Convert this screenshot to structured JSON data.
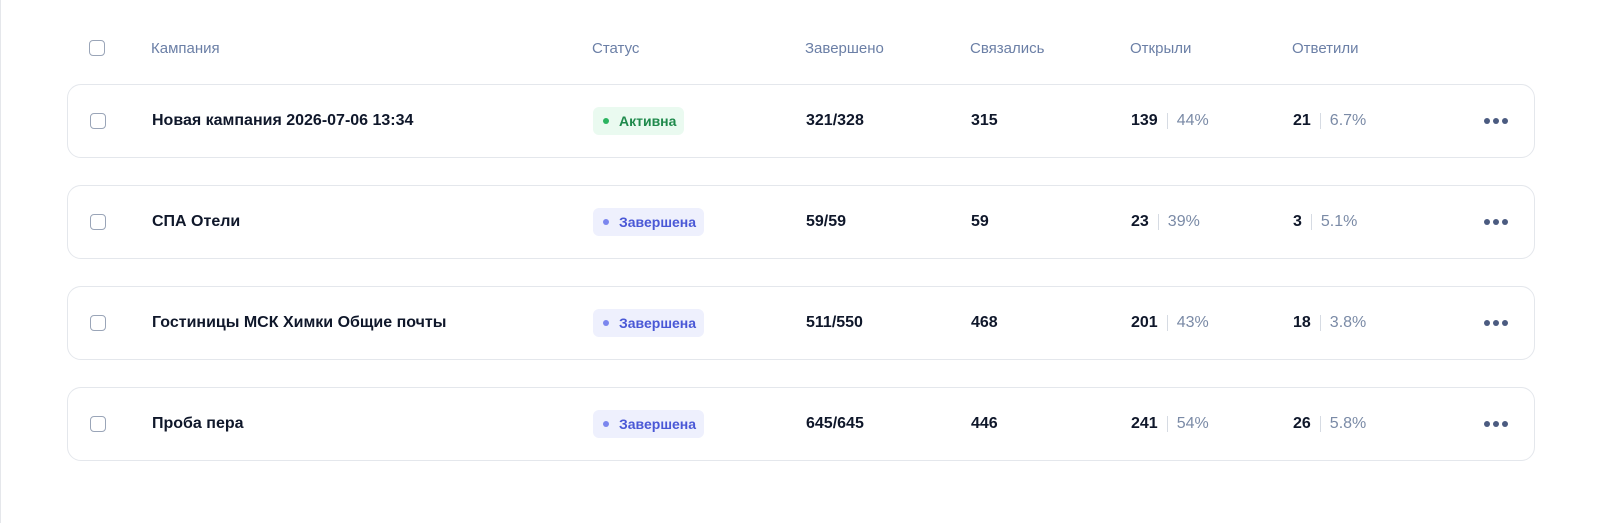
{
  "columns": {
    "campaign": "Кампания",
    "status": "Статус",
    "completed": "Завершено",
    "contacted": "Связались",
    "opened": "Открыли",
    "replied": "Ответили"
  },
  "colors": {
    "active_status": "#1f8a4c",
    "completed_status": "#4a58d6",
    "header_text": "#6b7fa6"
  },
  "rows": [
    {
      "name": "Новая кампания 2026-07-06 13:34",
      "status": "Активна",
      "status_type": "active",
      "completed": "321/328",
      "contacted": "315",
      "opened": "139",
      "opened_pct": "44%",
      "replied": "21",
      "replied_pct": "6.7%"
    },
    {
      "name": "СПА Отели",
      "status": "Завершена",
      "status_type": "done",
      "completed": "59/59",
      "contacted": "59",
      "opened": "23",
      "opened_pct": "39%",
      "replied": "3",
      "replied_pct": "5.1%"
    },
    {
      "name": "Гостиницы МСК Химки Общие почты",
      "status": "Завершена",
      "status_type": "done",
      "completed": "511/550",
      "contacted": "468",
      "opened": "201",
      "opened_pct": "43%",
      "replied": "18",
      "replied_pct": "3.8%"
    },
    {
      "name": "Проба пера",
      "status": "Завершена",
      "status_type": "done",
      "completed": "645/645",
      "contacted": "446",
      "opened": "241",
      "opened_pct": "54%",
      "replied": "26",
      "replied_pct": "5.8%"
    }
  ],
  "icons": {
    "more": "more-horizontal-icon"
  }
}
